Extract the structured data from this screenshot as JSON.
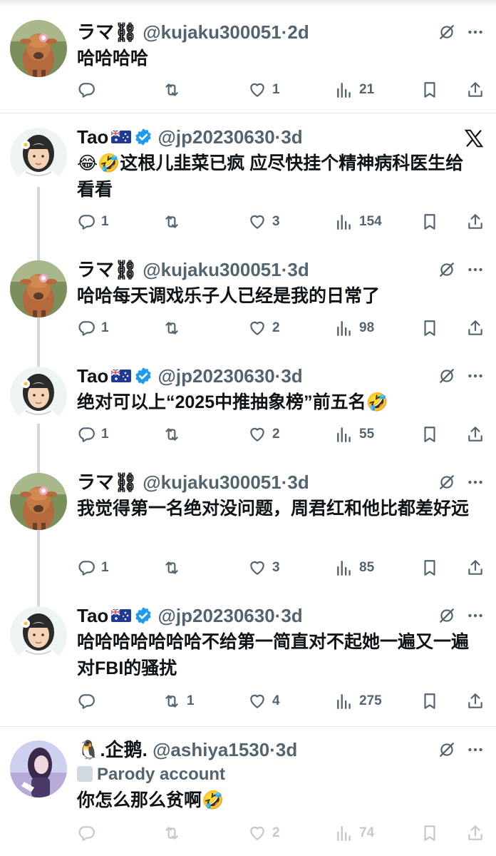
{
  "tweets": [
    {
      "name": "ラマ⛓",
      "handle": "@kujaku300051",
      "time": "·2d",
      "text": "哈哈哈哈",
      "reply": "",
      "retweet": "",
      "like": "1",
      "views": "21"
    },
    {
      "name": "Tao",
      "handle": "@jp20230630",
      "time": "·3d",
      "text": "😂🤣这根儿韭菜已疯 应尽快挂个精神病科医生给看看",
      "reply": "1",
      "retweet": "",
      "like": "3",
      "views": "154"
    },
    {
      "name": "ラマ⛓",
      "handle": "@kujaku300051",
      "time": "·3d",
      "text": "哈哈每天调戏乐子人已经是我的日常了",
      "reply": "1",
      "retweet": "",
      "like": "2",
      "views": "98"
    },
    {
      "name": "Tao",
      "handle": "@jp20230630",
      "time": "·3d",
      "text": "绝对可以上“2025中推抽象榜”前五名🤣",
      "reply": "1",
      "retweet": "",
      "like": "2",
      "views": "55"
    },
    {
      "name": "ラマ⛓",
      "handle": "@kujaku300051",
      "time": "·3d",
      "text": "我觉得第一名绝对没问题，周君红和他比都差好远",
      "reply": "1",
      "retweet": "",
      "like": "3",
      "views": "85"
    },
    {
      "name": "Tao",
      "handle": "@jp20230630",
      "time": "·3d",
      "text": "哈哈哈哈哈哈哈不给第一简直对不起她一遍又一遍对FBI的骚扰",
      "reply": "",
      "retweet": "1",
      "like": "4",
      "views": "275"
    },
    {
      "name": "🐧.企鹅.",
      "handle": "@ashiya1530",
      "time": "·3d",
      "parody": "Parody account",
      "text": "你怎么那么贫啊🤣",
      "reply": "",
      "retweet": "",
      "like": "2",
      "views": "74"
    }
  ],
  "colors": {
    "verified": "#1d9bf0",
    "icon": "#536471",
    "text": "#0f1419",
    "thread": "#cfd9de"
  },
  "icons": [
    "reply-icon",
    "retweet-icon",
    "like-icon",
    "views-icon",
    "bookmark-icon",
    "share-icon",
    "grok-icon",
    "more-icon",
    "x-logo-icon",
    "verified-icon",
    "flag-icon"
  ]
}
